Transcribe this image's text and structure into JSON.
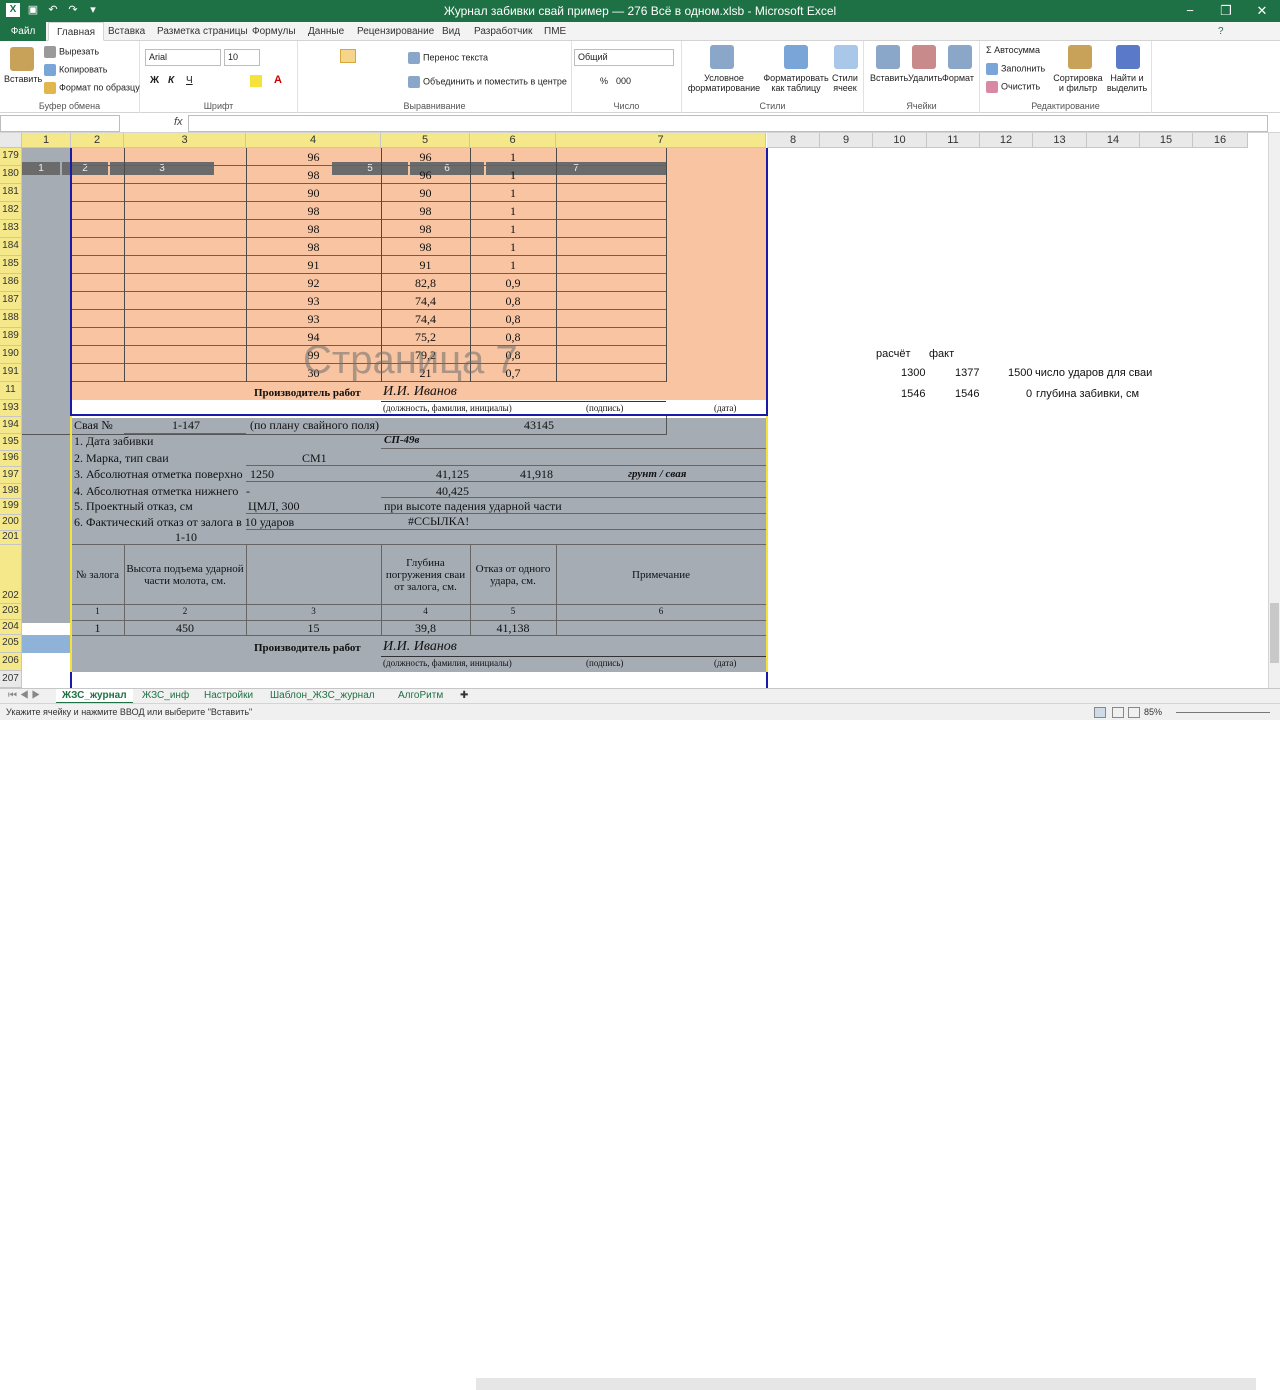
{
  "window": {
    "title": "Журнал забивки свай пример — 276 Всё в одном.xlsb - Microsoft Excel",
    "controls": [
      "−",
      "❐",
      "✕"
    ]
  },
  "ribbon_tabs": [
    "Файл",
    "Главная",
    "Вставка",
    "Разметка страницы",
    "Формулы",
    "Данные",
    "Рецензирование",
    "Вид",
    "Разработчик",
    "ПМЕ"
  ],
  "ribbon": {
    "clipboard": {
      "name": "Буфер обмена",
      "paste": "Вставить",
      "cut": "Вырезать",
      "copy": "Копировать",
      "format_painter": "Формат по образцу"
    },
    "font": {
      "name": "Шрифт",
      "family": "Arial",
      "size": "10",
      "bold": "Ж",
      "italic": "К",
      "underline": "Ч"
    },
    "alignment": {
      "name": "Выравнивание",
      "wrap": "Перенос текста",
      "merge": "Объединить и поместить в центре"
    },
    "number": {
      "name": "Число",
      "format": "Общий",
      "percent": "%",
      "thousands": "000"
    },
    "styles": {
      "name": "Стили",
      "cond": "Условное форматирование",
      "table": "Форматировать как таблицу",
      "cell": "Стили ячеек"
    },
    "cells": {
      "name": "Ячейки",
      "insert": "Вставить",
      "delete": "Удалить",
      "format": "Формат"
    },
    "editing": {
      "name": "Редактирование",
      "autosum": "Автосумма",
      "fill": "Заполнить",
      "clear": "Очистить",
      "sort": "Сортировка и фильтр",
      "find": "Найти и выделить"
    }
  },
  "formula_bar": {
    "fx": "fx",
    "value": ""
  },
  "columns": [
    {
      "label": "1",
      "sel": true
    },
    {
      "label": "2",
      "sel": true
    },
    {
      "label": "3",
      "sel": true
    },
    {
      "label": "4",
      "sel": true
    },
    {
      "label": "5",
      "sel": true
    },
    {
      "label": "6",
      "sel": true
    },
    {
      "label": "7",
      "sel": true
    },
    {
      "label": "8",
      "sel": false
    },
    {
      "label": "9",
      "sel": false
    },
    {
      "label": "10",
      "sel": false
    },
    {
      "label": "11",
      "sel": false
    },
    {
      "label": "12",
      "sel": false
    },
    {
      "label": "13",
      "sel": false
    },
    {
      "label": "14",
      "sel": false
    },
    {
      "label": "15",
      "sel": false
    },
    {
      "label": "16",
      "sel": false
    }
  ],
  "row_numbers": [
    "179",
    "180",
    "181",
    "182",
    "183",
    "184",
    "185",
    "186",
    "187",
    "188",
    "189",
    "190",
    "191",
    "11",
    "193",
    "194",
    "195",
    "196",
    "197",
    "198",
    "199",
    "200",
    "201",
    "202",
    "203",
    "204",
    "205",
    "206",
    "207"
  ],
  "frozen_header": [
    "1",
    "2",
    "3",
    "5",
    "6",
    "7"
  ],
  "data_rows": [
    [
      "96",
      "96",
      "1"
    ],
    [
      "98",
      "96",
      "1"
    ],
    [
      "90",
      "90",
      "1"
    ],
    [
      "98",
      "98",
      "1"
    ],
    [
      "98",
      "98",
      "1"
    ],
    [
      "98",
      "98",
      "1"
    ],
    [
      "91",
      "91",
      "1"
    ],
    [
      "92",
      "82,8",
      "0,9"
    ],
    [
      "93",
      "74,4",
      "0,8"
    ],
    [
      "93",
      "74,4",
      "0,8"
    ],
    [
      "94",
      "75,2",
      "0,8"
    ],
    [
      "99",
      "79,2",
      "0,8"
    ],
    [
      "30",
      "21",
      "0,7"
    ]
  ],
  "watermark": "Страница 7",
  "signature": {
    "label": "Производитель работ",
    "name": "И.И. Иванов",
    "role": "(должность, фамилия, инициалы)",
    "sign": "(подпись)",
    "date": "(дата)"
  },
  "pile": {
    "label": "Свая №",
    "number": "1-147",
    "plan": "(по плану свайного поля)",
    "code": "43145",
    "date_label": "1. Дата забивки",
    "date_value": "СП-49в",
    "brand_label": "2. Марка, тип сваи",
    "brand_value": "СМ1",
    "abs_label": "3. Абсолютная отметка поверхно",
    "abs_len": "1250",
    "abs_v1": "41,125",
    "abs_v2": "41,918",
    "abs_note": "грунт / свая",
    "low_label": "4. Абсолютная отметка нижнего",
    "low_dash": "-",
    "low_value": "40,425",
    "design_label": "5. Проектный отказ, см",
    "design_value": "ЦМЛ, 300",
    "design_note": "при высоте падения ударной части",
    "fact_label": "6. Фактический отказ от залога в 10 ударов",
    "fact_value": "#ССЫЛКА!",
    "range": "1-10"
  },
  "table2": {
    "headers": [
      "№ залога",
      "Высота подъема ударной части молота, см.",
      "",
      "Глубина погружения сваи от залога, см.",
      "Отказ от одного удара, см.",
      "Примечание"
    ],
    "numbers": [
      "1",
      "2",
      "3",
      "4",
      "5",
      "6"
    ],
    "row": [
      "1",
      "450",
      "15",
      "39,8",
      "41,138",
      ""
    ]
  },
  "side": {
    "h1": "расчёт",
    "h2": "факт",
    "r1": [
      "1300",
      "1377",
      "1500",
      "число ударов для сваи"
    ],
    "r2": [
      "1546",
      "1546",
      "0",
      "глубина забивки, см"
    ]
  },
  "sheets": [
    {
      "label": "ЖЗС_журнал",
      "active": true
    },
    {
      "label": "ЖЗС_инф",
      "active": false
    },
    {
      "label": "Настройки",
      "active": false
    },
    {
      "label": "Шаблон_ЖЗС_журнал",
      "active": false
    },
    {
      "label": "АлгоРитм",
      "active": false
    }
  ],
  "status": {
    "message": "Укажите ячейку и нажмите ВВОД или выберите \"Вставить\"",
    "zoom": "85%"
  },
  "colors": {
    "excel_green": "#1e7145",
    "orange_fill": "#f8c4a1",
    "gray_fill": "#a5acb4",
    "selected_header": "#f4e88a",
    "print_blue": "#1a1aa8",
    "print_yellow": "#f5e23a"
  }
}
